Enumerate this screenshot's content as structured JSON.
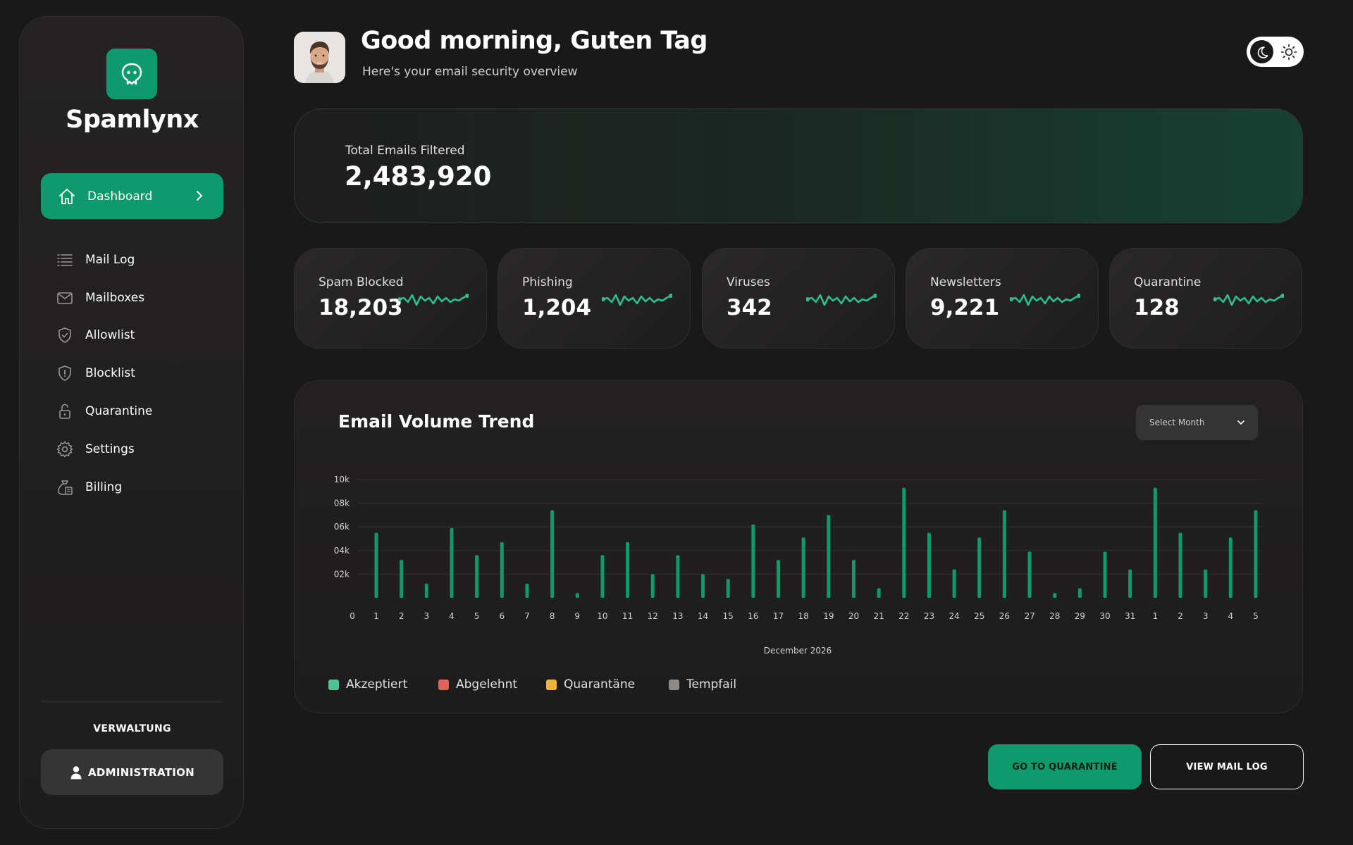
{
  "sidebar": {
    "brand": "Spamlynx",
    "active_item": {
      "label": "Dashboard",
      "icon": "home-icon"
    },
    "items": [
      {
        "label": "Mail Log",
        "icon": "list-icon"
      },
      {
        "label": "Mailboxes",
        "icon": "mail-icon"
      },
      {
        "label": "Allowlist",
        "icon": "shield-check-icon"
      },
      {
        "label": "Blocklist",
        "icon": "shield-alert-icon"
      },
      {
        "label": "Quarantine",
        "icon": "unlock-icon"
      },
      {
        "label": "Settings",
        "icon": "gear-icon"
      },
      {
        "label": "Billing",
        "icon": "billing-icon"
      }
    ],
    "section_label": "VERWALTUNG",
    "admin_button": "ADMINISTRATION"
  },
  "header": {
    "greeting": "Good morning, Guten Tag",
    "subtitle": "Here's your email security overview"
  },
  "total": {
    "label": "Total Emails Filtered",
    "value": "2,483,920"
  },
  "stats": [
    {
      "label": "Spam Blocked",
      "value": "18,203"
    },
    {
      "label": "Phishing",
      "value": "1,204"
    },
    {
      "label": "Viruses",
      "value": "342"
    },
    {
      "label": "Newsletters",
      "value": "9,221"
    },
    {
      "label": "Quarantine",
      "value": "128"
    }
  ],
  "chart": {
    "title": "Email Volume Trend",
    "select_placeholder": "Select Month"
  },
  "chart_data": {
    "type": "bar",
    "title": "Email Volume Trend",
    "xlabel": "December 2026",
    "ylabel": "",
    "y_ticks": [
      "02k",
      "04k",
      "06k",
      "08k",
      "10k"
    ],
    "y_origin_label": "0",
    "ylim": [
      0,
      10000
    ],
    "categories": [
      "1",
      "2",
      "3",
      "4",
      "5",
      "6",
      "7",
      "8",
      "9",
      "10",
      "11",
      "12",
      "13",
      "14",
      "15",
      "16",
      "17",
      "18",
      "19",
      "20",
      "21",
      "22",
      "23",
      "24",
      "25",
      "26",
      "27",
      "28",
      "29",
      "30",
      "31",
      "1",
      "2",
      "3",
      "4",
      "5"
    ],
    "series": [
      {
        "name": "Akzeptiert",
        "color": "#0e9a6c",
        "values": [
          5500,
          3200,
          1200,
          5900,
          3600,
          4700,
          1200,
          7400,
          400,
          3600,
          4700,
          2000,
          3600,
          2000,
          1600,
          6200,
          3200,
          5100,
          7000,
          3200,
          800,
          9300,
          5500,
          2400,
          5100,
          7400,
          3900,
          400,
          800,
          3900,
          2400,
          9300,
          5500,
          2400,
          5100,
          7400
        ]
      }
    ],
    "legend": [
      {
        "name": "Akzeptiert",
        "color": "#4ec38f"
      },
      {
        "name": "Abgelehnt",
        "color": "#e0625b"
      },
      {
        "name": "Quarantäne",
        "color": "#f0b43c"
      },
      {
        "name": "Tempfail",
        "color": "#8d8a88"
      }
    ]
  },
  "actions": {
    "quarantine": "GO TO QUARANTINE",
    "maillog": "VIEW MAIL LOG"
  }
}
